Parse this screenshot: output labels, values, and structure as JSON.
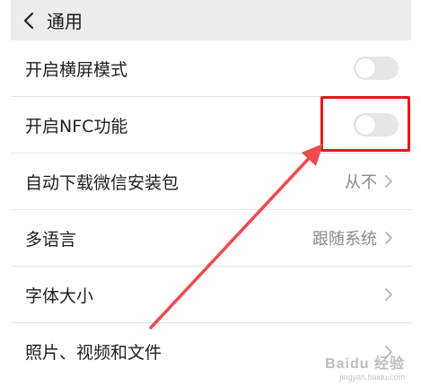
{
  "header": {
    "title": "通用"
  },
  "settings": [
    {
      "label": "开启横屏模式",
      "type": "toggle",
      "enabled": false
    },
    {
      "label": "开启NFC功能",
      "type": "toggle",
      "enabled": false
    },
    {
      "label": "自动下载微信安装包",
      "type": "select",
      "value": "从不"
    },
    {
      "label": "多语言",
      "type": "select",
      "value": "跟随系统"
    },
    {
      "label": "字体大小",
      "type": "link"
    },
    {
      "label": "照片、视频和文件",
      "type": "link"
    }
  ],
  "annotation": {
    "highlight_color": "#e8151c",
    "arrow_color": "#f04a4e"
  },
  "watermark": {
    "line1": "Baidu 经验",
    "line2": "jingyan.baidu.com"
  }
}
